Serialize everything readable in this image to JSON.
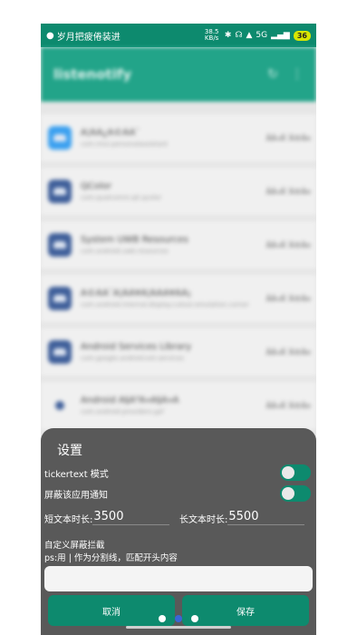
{
  "status_bar": {
    "carrier_text": "岁月把疲倦装进",
    "network_speed": "38.5 KB/s",
    "signal_text": "5G",
    "battery": "36"
  },
  "app_bar": {
    "title": "listenotify"
  },
  "app_list": [
    {
      "name": "Ã¦ÂÂ¿Ã©ÂÂ¨",
      "package": "com.miui.personalassistant",
      "tag": "ÃÂ»Ã¨Â®Â¤",
      "icon": "blue-app-icon"
    },
    {
      "name": "QColor",
      "package": "com.qualcomm.qti.qcolor",
      "tag": "ÃÂ»Ã¨Â®Â¤",
      "icon": "android-icon"
    },
    {
      "name": "System UWB Resources",
      "package": "com.android.uwb.resources",
      "tag": "ÃÂ»Ã¨Â®Â¤",
      "icon": "android-icon"
    },
    {
      "name": "Ã©ÂÂ¨Ã¦ÂÂ¥Ã¦ÂÂÃ¥ÂÂ¡",
      "package": "com.android.internal.display.cutout.emulation.corner",
      "tag": "ÃÂ»Ã¨Â®Â¤",
      "icon": "android-icon"
    },
    {
      "name": "Android Services Library",
      "package": "com.google.android.ext.services",
      "tag": "ÃÂ»Ã¨Â®Â¤",
      "icon": "android-icon"
    },
    {
      "name": "Android Ã§Â³Â»Ã§Â»Â",
      "package": "com.android.providers.gsf",
      "tag": "ÃÂ»Ã¨Â®Â¤",
      "icon": "settings-gear-icon"
    }
  ],
  "dialog": {
    "title": "设置",
    "ticker_mode_label": "tickertext 模式",
    "block_app_label": "屏蔽该应用通知",
    "short_text_label": "短文本时长:",
    "short_text_value": "3500",
    "long_text_label": "长文本时长:",
    "long_text_value": "5500",
    "custom_block_label": "自定义屏蔽拦截",
    "custom_block_hint": "ps:用 | 作为分割线，匹配开头内容",
    "custom_block_value": "",
    "cancel_label": "取消",
    "save_label": "保存"
  },
  "colors": {
    "accent": "#0d8a6e",
    "app_bar": "#22a489",
    "dialog_bg": "#595959"
  }
}
